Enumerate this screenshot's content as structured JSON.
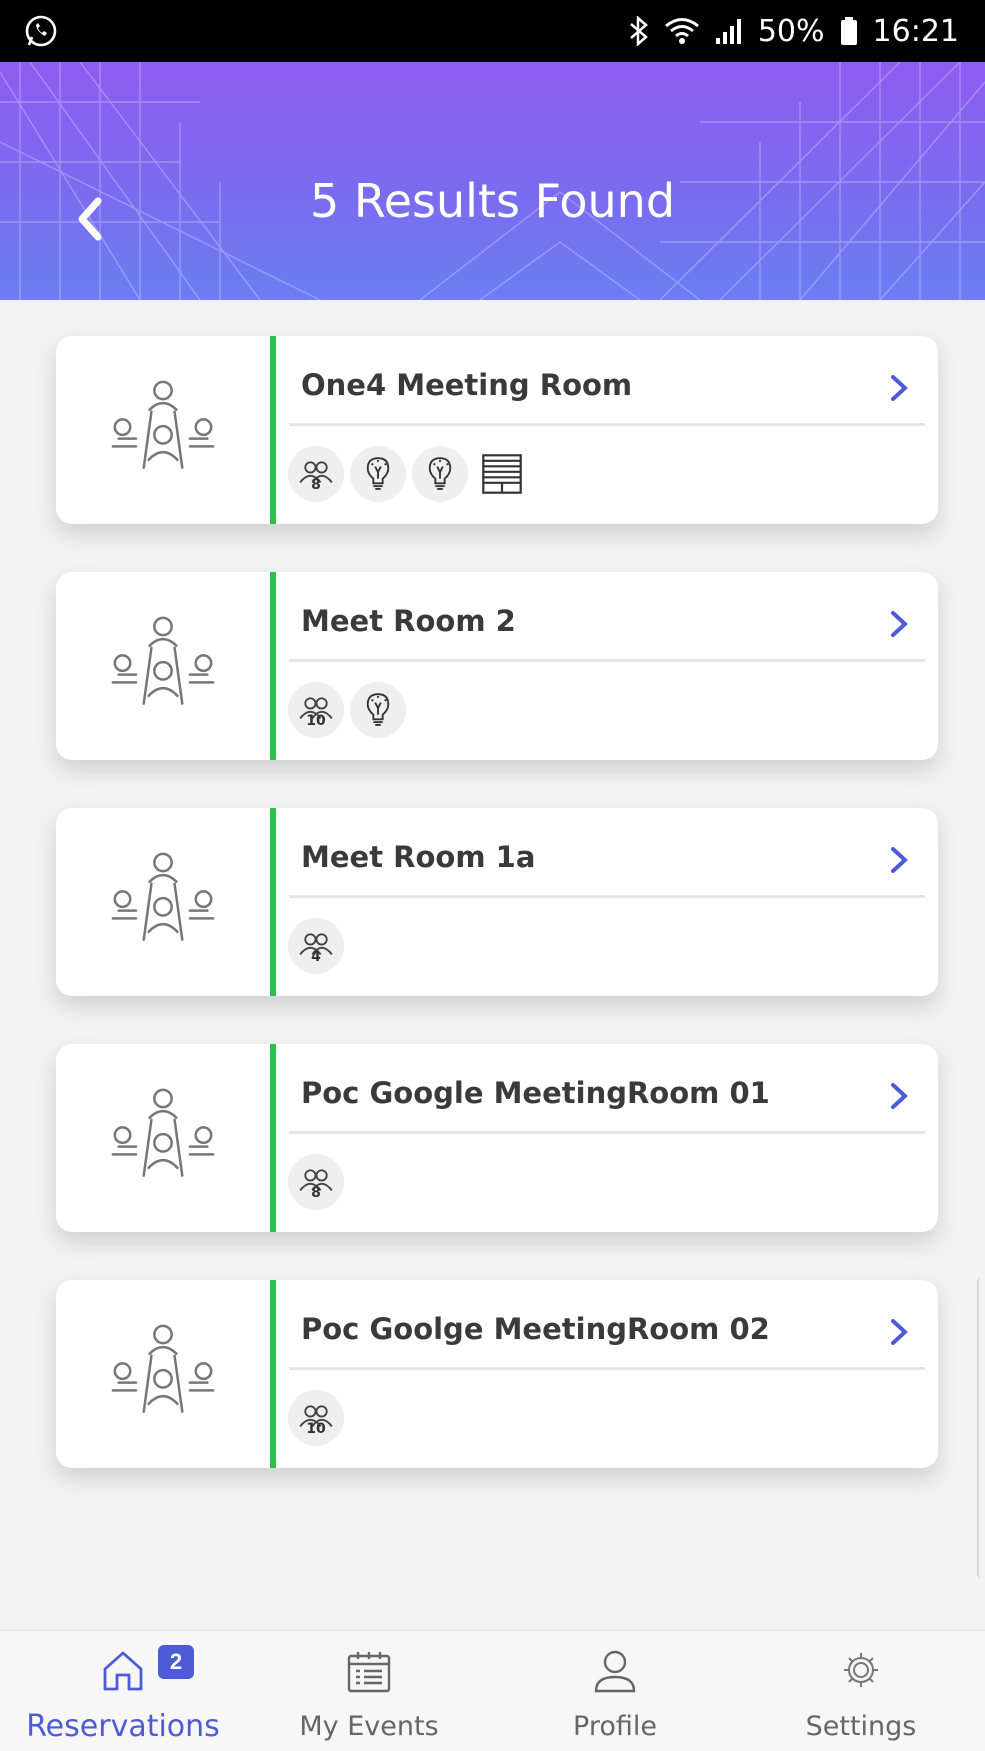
{
  "status_bar": {
    "battery": "50%",
    "time": "16:21"
  },
  "header": {
    "title": "5 Results Found"
  },
  "rooms": [
    {
      "name": "One4 Meeting Room",
      "capacity": "8",
      "amenities": [
        "capacity-icon",
        "lightbulb-icon",
        "lightbulb-icon",
        "blinds-icon"
      ]
    },
    {
      "name": "Meet Room 2",
      "capacity": "10",
      "amenities": [
        "capacity-icon",
        "lightbulb-icon"
      ]
    },
    {
      "name": "Meet Room 1a",
      "capacity": "4",
      "amenities": [
        "capacity-icon"
      ]
    },
    {
      "name": "Poc Google MeetingRoom 01",
      "capacity": "8",
      "amenities": [
        "capacity-icon"
      ]
    },
    {
      "name": "Poc Goolge MeetingRoom 02",
      "capacity": "10",
      "amenities": [
        "capacity-icon"
      ]
    }
  ],
  "bottom_nav": {
    "items": [
      {
        "label": "Reservations",
        "icon": "home-icon",
        "active": true,
        "badge": "2"
      },
      {
        "label": "My Events",
        "icon": "calendar-icon"
      },
      {
        "label": "Profile",
        "icon": "user-icon"
      },
      {
        "label": "Settings",
        "icon": "gear-icon"
      }
    ]
  },
  "colors": {
    "accent": "#4d5bd6",
    "available": "#2fbf4f",
    "header_top": "#8e5cf0",
    "header_bottom": "#6b7ef2"
  }
}
